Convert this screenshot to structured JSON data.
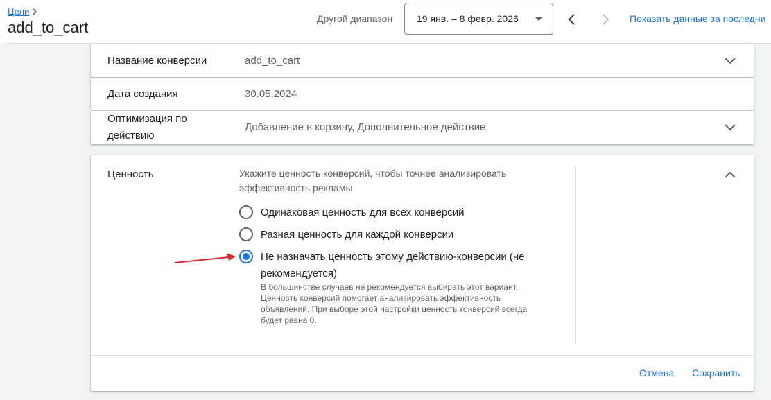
{
  "header": {
    "breadcrumb": "Цели",
    "title": "add_to_cart",
    "range_label": "Другой диапазон",
    "date_range": "19 янв. – 8 февр. 2026",
    "show_data_link": "Показать данные за последни"
  },
  "rows": [
    {
      "label": "Название конверсии",
      "value": "add_to_cart"
    },
    {
      "label": "Дата создания",
      "value": "30.05.2024"
    },
    {
      "label_line1": "Оптимизация по",
      "label_line2": "действию",
      "value": "Добавление в корзину, Дополнительное действие"
    }
  ],
  "value_section": {
    "label": "Ценность",
    "description_line1": "Укажите ценность конверсий, чтобы точнее анализировать",
    "description_line2": "эффективность рекламы.",
    "options": [
      {
        "label": "Одинаковая ценность для всех конверсий",
        "checked": false
      },
      {
        "label": "Разная ценность для каждой конверсии",
        "checked": false
      },
      {
        "label_line1": "Не назначать ценность этому действию-конверсии (не",
        "label_line2": "рекомендуется)",
        "checked": true
      }
    ],
    "helper_lines": [
      "В большинстве случаев не рекомендуется выбирать этот вариант.",
      "Ценность конверсий помогает анализировать эффективность",
      "объявлений. При выборе этой настройки ценность конверсий всегда",
      "будет равна 0."
    ],
    "cancel": "Отмена",
    "save": "Сохранить"
  },
  "colors": {
    "accent": "#1a73e8",
    "annotation_arrow": "#d32f2f"
  }
}
